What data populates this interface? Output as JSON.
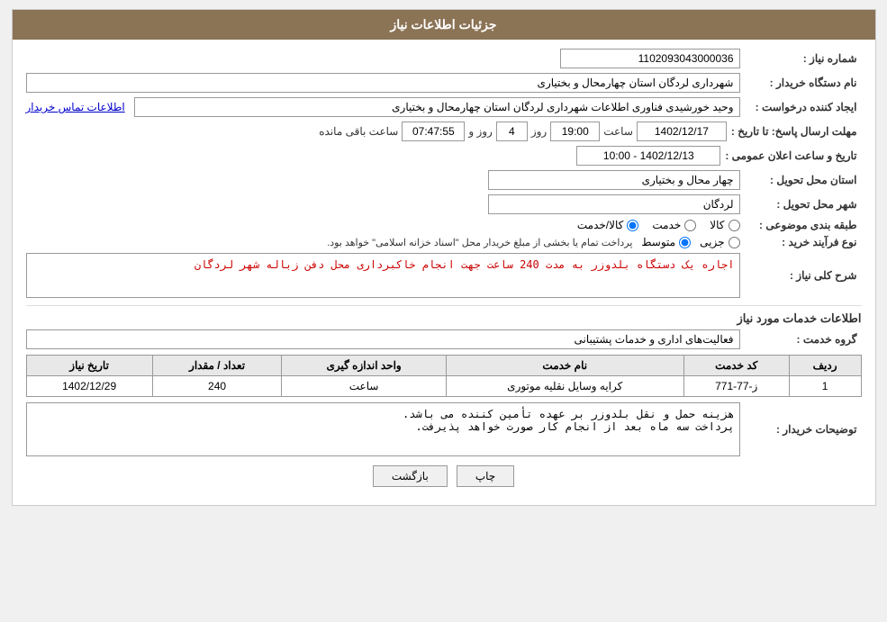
{
  "header": {
    "title": "جزئیات اطلاعات نیاز"
  },
  "fields": {
    "need_number_label": "شماره نیاز :",
    "need_number_value": "1102093043000036",
    "buyer_name_label": "نام دستگاه خریدار :",
    "buyer_name_value": "شهرداری لردگان استان چهارمحال و بختیاری",
    "creator_label": "ایجاد کننده درخواست :",
    "creator_value": "وحید خورشیدی فناوری اطلاعات شهرداری لردگان استان چهارمحال و بختیاری",
    "creator_link": "اطلاعات تماس خریدار",
    "reply_deadline_label": "مهلت ارسال پاسخ: تا تاریخ :",
    "reply_date": "1402/12/17",
    "reply_time": "19:00",
    "reply_days": "4",
    "reply_counter": "07:47:55",
    "reply_days_label": "روز و",
    "reply_remaining_label": "ساعت باقی مانده",
    "delivery_province_label": "استان محل تحویل :",
    "delivery_province_value": "چهار محال و بختیاری",
    "delivery_city_label": "شهر محل تحویل :",
    "delivery_city_value": "لردگان",
    "subject_label": "طبقه بندی موضوعی :",
    "subject_options": [
      "کالا",
      "خدمت",
      "کالا/خدمت"
    ],
    "subject_selected": "کالا/خدمت",
    "purchase_type_label": "نوع فرآیند خرید :",
    "purchase_options": [
      "جزیی",
      "متوسط"
    ],
    "purchase_selected": "متوسط",
    "purchase_desc": "پرداخت تمام یا بخشی از مبلغ خریدار محل \"اسناد خزانه اسلامی\" خواهد بود.",
    "announcement_label": "تاریخ و ساعت اعلان عمومی :",
    "announcement_value": "1402/12/13 - 10:00",
    "description_label": "شرح کلی نیاز :",
    "description_value": "اجاره یک دستگاه بلدوزر به مدت 240 ساعت جهت انجام خاکبرداری محل دفن زباله شهر لردگان",
    "services_section": "اطلاعات خدمات مورد نیاز",
    "service_group_label": "گروه خدمت :",
    "service_group_value": "فعالیت‌های اداری و خدمات پشتیبانی",
    "table": {
      "columns": [
        "ردیف",
        "کد خدمت",
        "نام خدمت",
        "واحد اندازه گیری",
        "تعداد / مقدار",
        "تاریخ نیاز"
      ],
      "rows": [
        {
          "row": "1",
          "code": "ز-77-771",
          "name": "کرایه وسایل نقلیه موتوری",
          "unit": "ساعت",
          "quantity": "240",
          "date": "1402/12/29"
        }
      ]
    },
    "buyer_notes_label": "توضیحات خریدار :",
    "buyer_notes_value": "هزینه حمل و نقل بلدوزر بر عهده تأمین کننده می باشد.\nپرداخت سه ماه بعد از انجام کار صورت خواهد پذیرفت.",
    "btn_print": "چاپ",
    "btn_back": "بازگشت"
  }
}
